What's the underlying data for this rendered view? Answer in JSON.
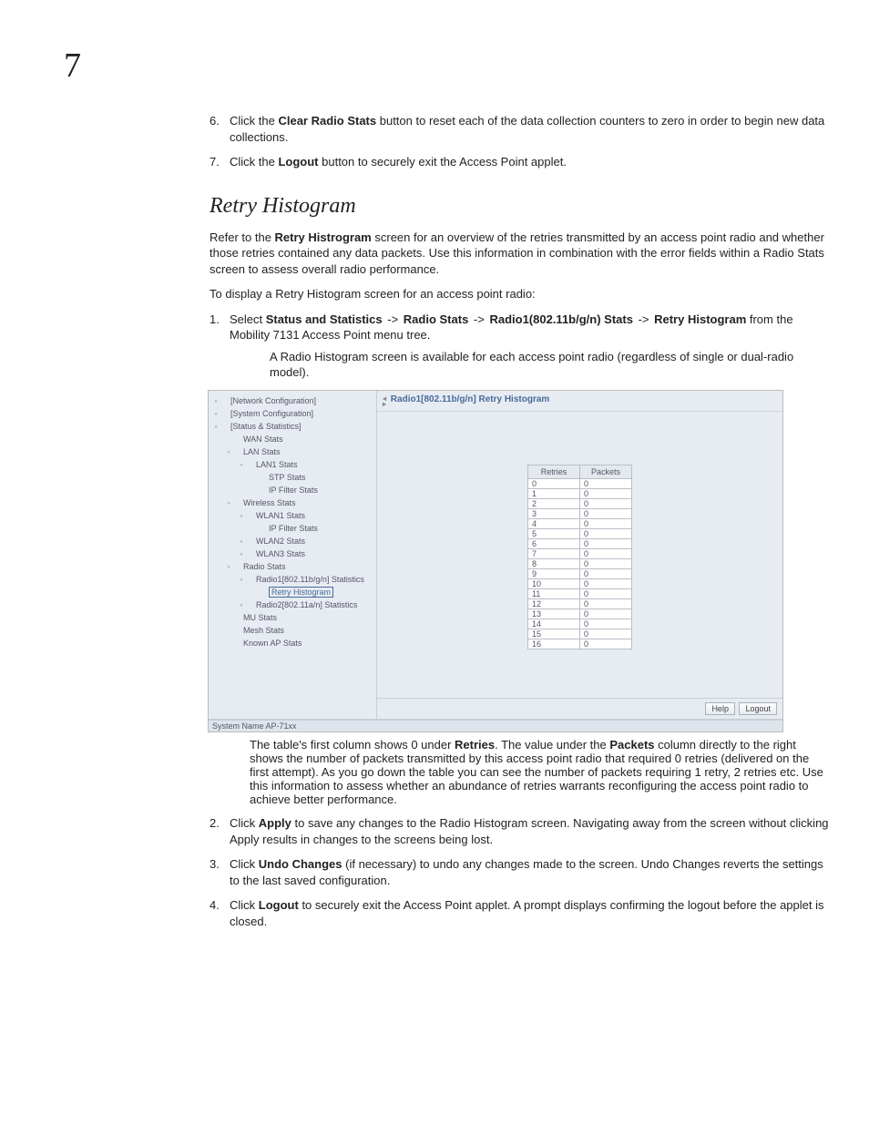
{
  "chapter_number": "7",
  "top_list": [
    {
      "num": "6.",
      "pre": "Click the ",
      "bold": "Clear Radio Stats",
      "post": " button to reset each of the data collection counters to zero in order to begin new data collections."
    },
    {
      "num": "7.",
      "pre": "Click the ",
      "bold": "Logout",
      "post": " button to securely exit the Access Point applet."
    }
  ],
  "section_title": "Retry Histogram",
  "intro_para_pre": "Refer to the ",
  "intro_para_bold": "Retry Histrogram",
  "intro_para_post": " screen for an overview of the retries transmitted by an access point radio and whether those retries contained any data packets. Use this information in combination with the error fields within a Radio Stats screen to assess overall radio performance.",
  "lead_in": "To display a Retry Histogram screen for an access point radio:",
  "step1": {
    "num": "1.",
    "pre": "Select ",
    "path": [
      "Status and Statistics",
      "Radio Stats",
      "Radio1(802.11b/g/n) Stats",
      "Retry Histogram"
    ],
    "arrow": " -> ",
    "post": " from the Mobility 7131 Access Point menu tree.",
    "note": "A Radio Histogram screen is available for each access point radio (regardless of single or dual-radio model)."
  },
  "screenshot": {
    "pane_title": "Radio1[802.11b/g/n] Retry Histogram",
    "tree": [
      {
        "lv": 1,
        "twist": "◦",
        "label": "[Network Configuration]"
      },
      {
        "lv": 1,
        "twist": "◦",
        "label": "[System Configuration]"
      },
      {
        "lv": 1,
        "twist": "◦",
        "label": "[Status & Statistics]"
      },
      {
        "lv": 2,
        "twist": "",
        "label": "WAN Stats"
      },
      {
        "lv": 2,
        "twist": "◦",
        "label": "LAN Stats"
      },
      {
        "lv": 3,
        "twist": "◦",
        "label": "LAN1 Stats"
      },
      {
        "lv": 4,
        "twist": "",
        "label": "STP Stats"
      },
      {
        "lv": 4,
        "twist": "",
        "label": "IP Filter Stats"
      },
      {
        "lv": 2,
        "twist": "◦",
        "label": "Wireless Stats"
      },
      {
        "lv": 3,
        "twist": "◦",
        "label": "WLAN1 Stats"
      },
      {
        "lv": 4,
        "twist": "",
        "label": "IP Filter Stats"
      },
      {
        "lv": 3,
        "twist": "◦",
        "label": "WLAN2 Stats"
      },
      {
        "lv": 3,
        "twist": "◦",
        "label": "WLAN3 Stats"
      },
      {
        "lv": 2,
        "twist": "◦",
        "label": "Radio Stats"
      },
      {
        "lv": 3,
        "twist": "◦",
        "label": "Radio1[802.11b/g/n] Statistics"
      },
      {
        "lv": 4,
        "twist": "",
        "label": "Retry Histogram",
        "selected": true
      },
      {
        "lv": 3,
        "twist": "◦",
        "label": "Radio2[802.11a/n] Statistics"
      },
      {
        "lv": 2,
        "twist": "",
        "label": "MU Stats"
      },
      {
        "lv": 2,
        "twist": "",
        "label": "Mesh Stats"
      },
      {
        "lv": 2,
        "twist": "",
        "label": "Known AP Stats"
      }
    ],
    "table": {
      "headers": [
        "Retries",
        "Packets"
      ],
      "rows": [
        [
          "0",
          "0"
        ],
        [
          "1",
          "0"
        ],
        [
          "2",
          "0"
        ],
        [
          "3",
          "0"
        ],
        [
          "4",
          "0"
        ],
        [
          "5",
          "0"
        ],
        [
          "6",
          "0"
        ],
        [
          "7",
          "0"
        ],
        [
          "8",
          "0"
        ],
        [
          "9",
          "0"
        ],
        [
          "10",
          "0"
        ],
        [
          "11",
          "0"
        ],
        [
          "12",
          "0"
        ],
        [
          "13",
          "0"
        ],
        [
          "14",
          "0"
        ],
        [
          "15",
          "0"
        ],
        [
          "16",
          "0"
        ]
      ]
    },
    "buttons": {
      "help": "Help",
      "logout": "Logout"
    },
    "status_bar": "System Name AP-71xx"
  },
  "after_shot": {
    "pre": "The table's first column shows 0 under ",
    "b1": "Retries",
    "mid1": ". The value under the ",
    "b2": "Packets",
    "post": " column directly to the right shows the number of packets transmitted by this access point radio that required 0 retries (delivered on the first attempt). As you go down the table you can see the number of packets requiring 1 retry, 2 retries etc. Use this information to assess whether an abundance of retries warrants reconfiguring the access point radio to achieve better performance."
  },
  "bottom_list": [
    {
      "num": "2.",
      "pre": "Click ",
      "bold": "Apply",
      "post": " to save any changes to the Radio Histogram screen. Navigating away from the screen without clicking Apply results in changes to the screens being lost."
    },
    {
      "num": "3.",
      "pre": "Click ",
      "bold": "Undo Changes",
      "post": " (if necessary) to undo any changes made to the screen. Undo Changes reverts the settings to the last saved configuration."
    },
    {
      "num": "4.",
      "pre": "Click ",
      "bold": "Logout",
      "post": " to securely exit the Access Point applet. A prompt displays confirming the logout before the applet is closed."
    }
  ]
}
